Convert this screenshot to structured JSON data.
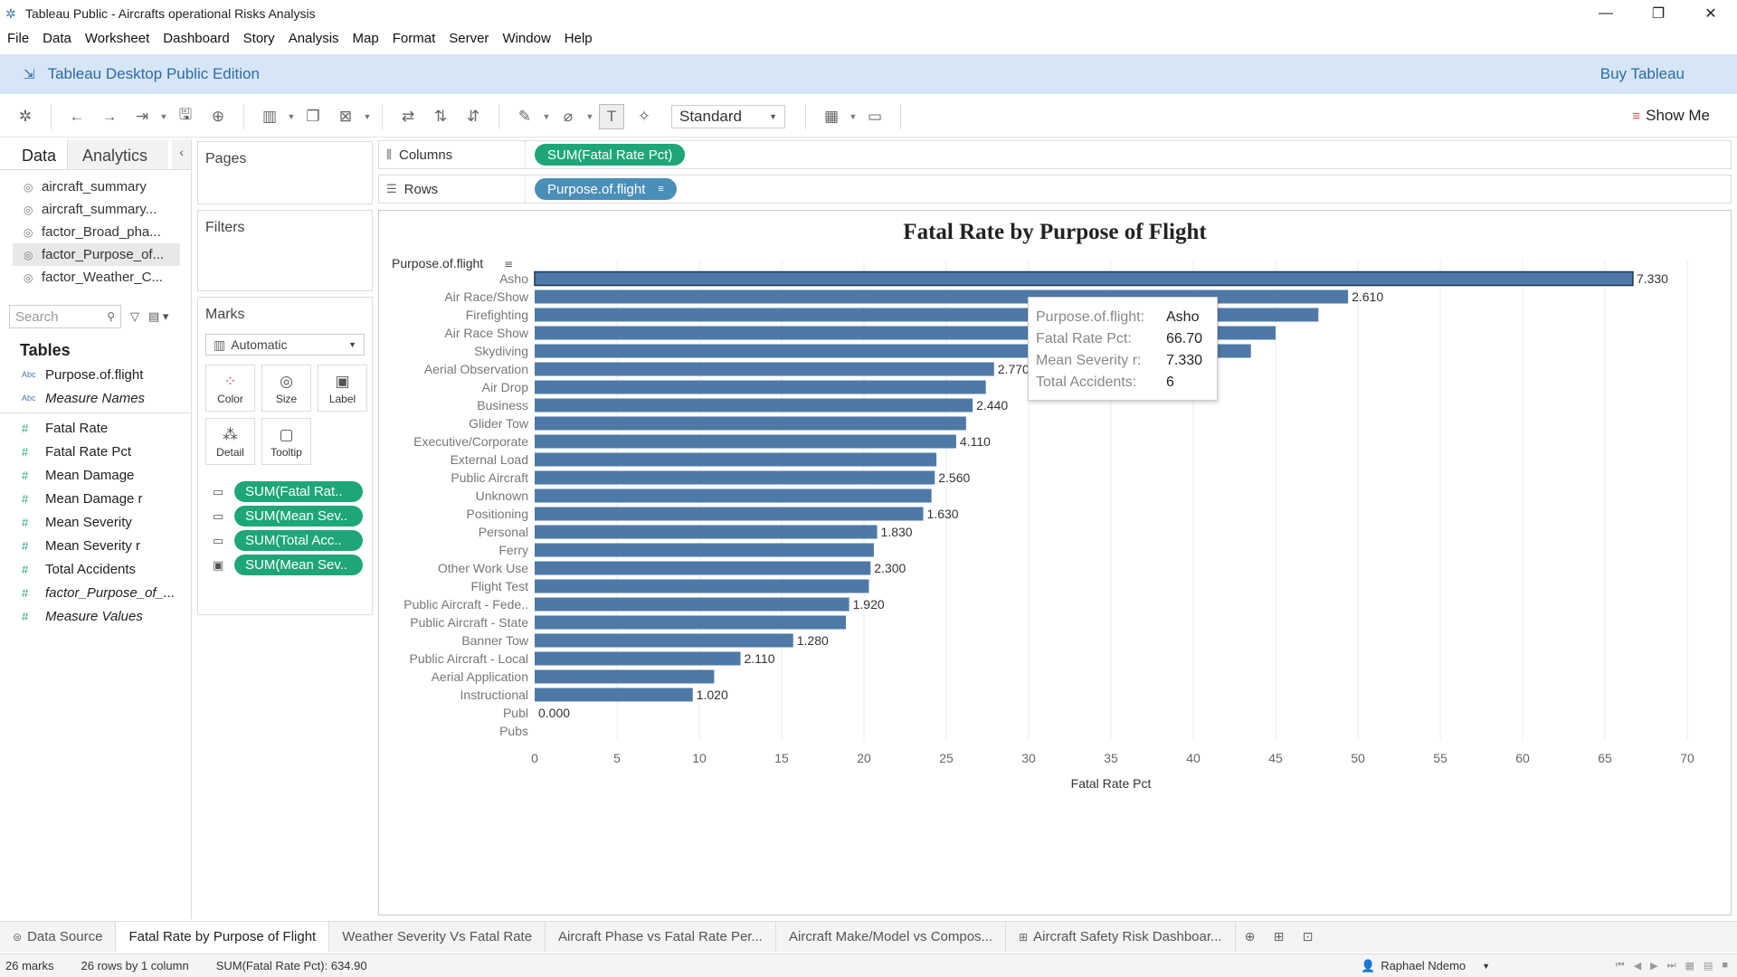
{
  "window": {
    "title": "Tableau Public - Aircrafts operational Risks Analysis",
    "minimize": "—",
    "restore": "❐",
    "close": "✕"
  },
  "menu": [
    "File",
    "Data",
    "Worksheet",
    "Dashboard",
    "Story",
    "Analysis",
    "Map",
    "Format",
    "Server",
    "Window",
    "Help"
  ],
  "banner": {
    "edition": "Tableau Desktop Public Edition",
    "buy": "Buy Tableau"
  },
  "toolbar": {
    "fit": "Standard",
    "show_me": "Show Me"
  },
  "data_pane": {
    "tab_data": "Data",
    "tab_analytics": "Analytics",
    "collapse": "‹",
    "sources": [
      "aircraft_summary",
      "aircraft_summary...",
      "factor_Broad_pha...",
      "factor_Purpose_of...",
      "factor_Weather_C..."
    ],
    "selected_source_index": 3,
    "search_placeholder": "Search",
    "tables_heading": "Tables",
    "dimensions": [
      {
        "label": "Purpose.of.flight",
        "type": "Abc",
        "italic": false
      },
      {
        "label": "Measure Names",
        "type": "Abc",
        "italic": true
      }
    ],
    "measures": [
      {
        "label": "Fatal Rate",
        "italic": false
      },
      {
        "label": "Fatal Rate Pct",
        "italic": false
      },
      {
        "label": "Mean Damage",
        "italic": false
      },
      {
        "label": "Mean Damage r",
        "italic": false
      },
      {
        "label": "Mean Severity",
        "italic": false
      },
      {
        "label": "Mean Severity r",
        "italic": false
      },
      {
        "label": "Total Accidents",
        "italic": false
      },
      {
        "label": "factor_Purpose_of_...",
        "italic": true
      },
      {
        "label": "Measure Values",
        "italic": true
      }
    ]
  },
  "cards": {
    "pages": "Pages",
    "filters": "Filters",
    "marks": "Marks",
    "mark_type": "Automatic",
    "buttons": [
      "Color",
      "Size",
      "Label",
      "Detail",
      "Tooltip"
    ],
    "mark_pills": [
      {
        "icon": "tooltip",
        "label": "SUM(Fatal Rat.."
      },
      {
        "icon": "tooltip",
        "label": "SUM(Mean Sev.."
      },
      {
        "icon": "tooltip",
        "label": "SUM(Total Acc.."
      },
      {
        "icon": "label",
        "label": "SUM(Mean Sev.."
      }
    ]
  },
  "shelves": {
    "columns_label": "Columns",
    "columns_pill": "SUM(Fatal Rate Pct)",
    "rows_label": "Rows",
    "rows_pill": "Purpose.of.flight"
  },
  "chart_data": {
    "type": "bar",
    "orientation": "horizontal",
    "title": "Fatal Rate by Purpose of Flight",
    "row_header": "Purpose.of.flight",
    "xlabel": "Fatal Rate Pct",
    "xlim": [
      0,
      70
    ],
    "xticks": [
      0,
      5,
      10,
      15,
      20,
      25,
      30,
      35,
      40,
      45,
      50,
      55,
      60,
      65,
      70
    ],
    "grid": true,
    "bar_color": "#4e79a7",
    "categories": [
      "Asho",
      "Air Race/Show",
      "Firefighting",
      "Air Race Show",
      "Skydiving",
      "Aerial Observation",
      "Air Drop",
      "Business",
      "Glider Tow",
      "Executive/Corporate",
      "External Load",
      "Public Aircraft",
      "Unknown",
      "Positioning",
      "Personal",
      "Ferry",
      "Other Work Use",
      "Flight Test",
      "Public Aircraft - Fede..",
      "Public Aircraft - State",
      "Banner Tow",
      "Public Aircraft - Local",
      "Aerial Application",
      "Instructional",
      "Publ",
      "Pubs"
    ],
    "values": [
      66.7,
      49.4,
      47.6,
      45.0,
      43.5,
      27.9,
      27.4,
      26.6,
      26.2,
      25.6,
      24.4,
      24.3,
      24.1,
      23.6,
      20.8,
      20.6,
      20.4,
      20.3,
      19.1,
      18.9,
      15.7,
      12.5,
      10.9,
      9.6,
      0.0,
      null
    ],
    "labels": [
      "7.330",
      "2.610",
      "",
      "",
      "",
      "2.770",
      "",
      "2.440",
      "",
      "4.110",
      "",
      "2.560",
      "",
      "1.630",
      "1.830",
      "",
      "2.300",
      "",
      "1.920",
      "",
      "1.280",
      "2.110",
      "",
      "1.020",
      "0.000",
      ""
    ],
    "highlighted_index": 0
  },
  "tooltip": [
    {
      "key": "Purpose.of.flight:",
      "value": "Asho"
    },
    {
      "key": "Fatal Rate Pct:",
      "value": "66.70"
    },
    {
      "key": "Mean Severity r:",
      "value": "7.330"
    },
    {
      "key": "Total Accidents:",
      "value": "6"
    }
  ],
  "sheet_tabs": {
    "data_source": "Data Source",
    "sheets": [
      "Fatal Rate by Purpose of Flight",
      "Weather Severity Vs Fatal Rate",
      "Aircraft Phase vs Fatal Rate Per...",
      "Aircraft Make/Model vs Compos...",
      "Aircraft Safety Risk Dashboar..."
    ],
    "active_index": 0
  },
  "status": {
    "marks": "26 marks",
    "shape": "26 rows by 1 column",
    "sum": "SUM(Fatal Rate Pct): 634.90",
    "user": "Raphael Ndemo"
  }
}
